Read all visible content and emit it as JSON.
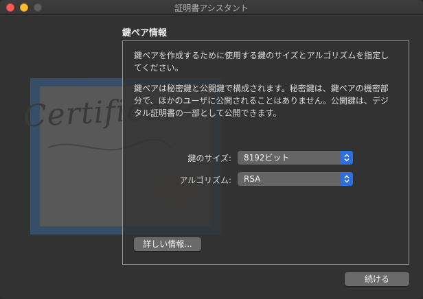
{
  "window": {
    "title": "証明書アシスタント"
  },
  "background_art": {
    "cert_word": "Certificate"
  },
  "section": {
    "title": "鍵ペア情報"
  },
  "description": {
    "para1": "鍵ペアを作成するために使用する鍵のサイズとアルゴリズムを指定してください。",
    "para2": "鍵ペアは秘密鍵と公開鍵で構成されます。秘密鍵は、鍵ペアの機密部分で、ほかのユーザに公開されることはありません。公開鍵は、デジタル証明書の一部として公開できます。"
  },
  "form": {
    "key_size_label": "鍵のサイズ:",
    "key_size_value": "8192ビット",
    "algorithm_label": "アルゴリズム:",
    "algorithm_value": "RSA"
  },
  "buttons": {
    "more_info": "詳しい情報...",
    "continue": "続ける"
  },
  "colors": {
    "accent": "#2d6fe0",
    "close": "#ff5f57",
    "minimize": "#febc2e",
    "zoom_disabled": "#5d5d5d"
  },
  "icons": [
    "close-icon",
    "minimize-icon",
    "zoom-icon",
    "chevron-updown-icon"
  ]
}
